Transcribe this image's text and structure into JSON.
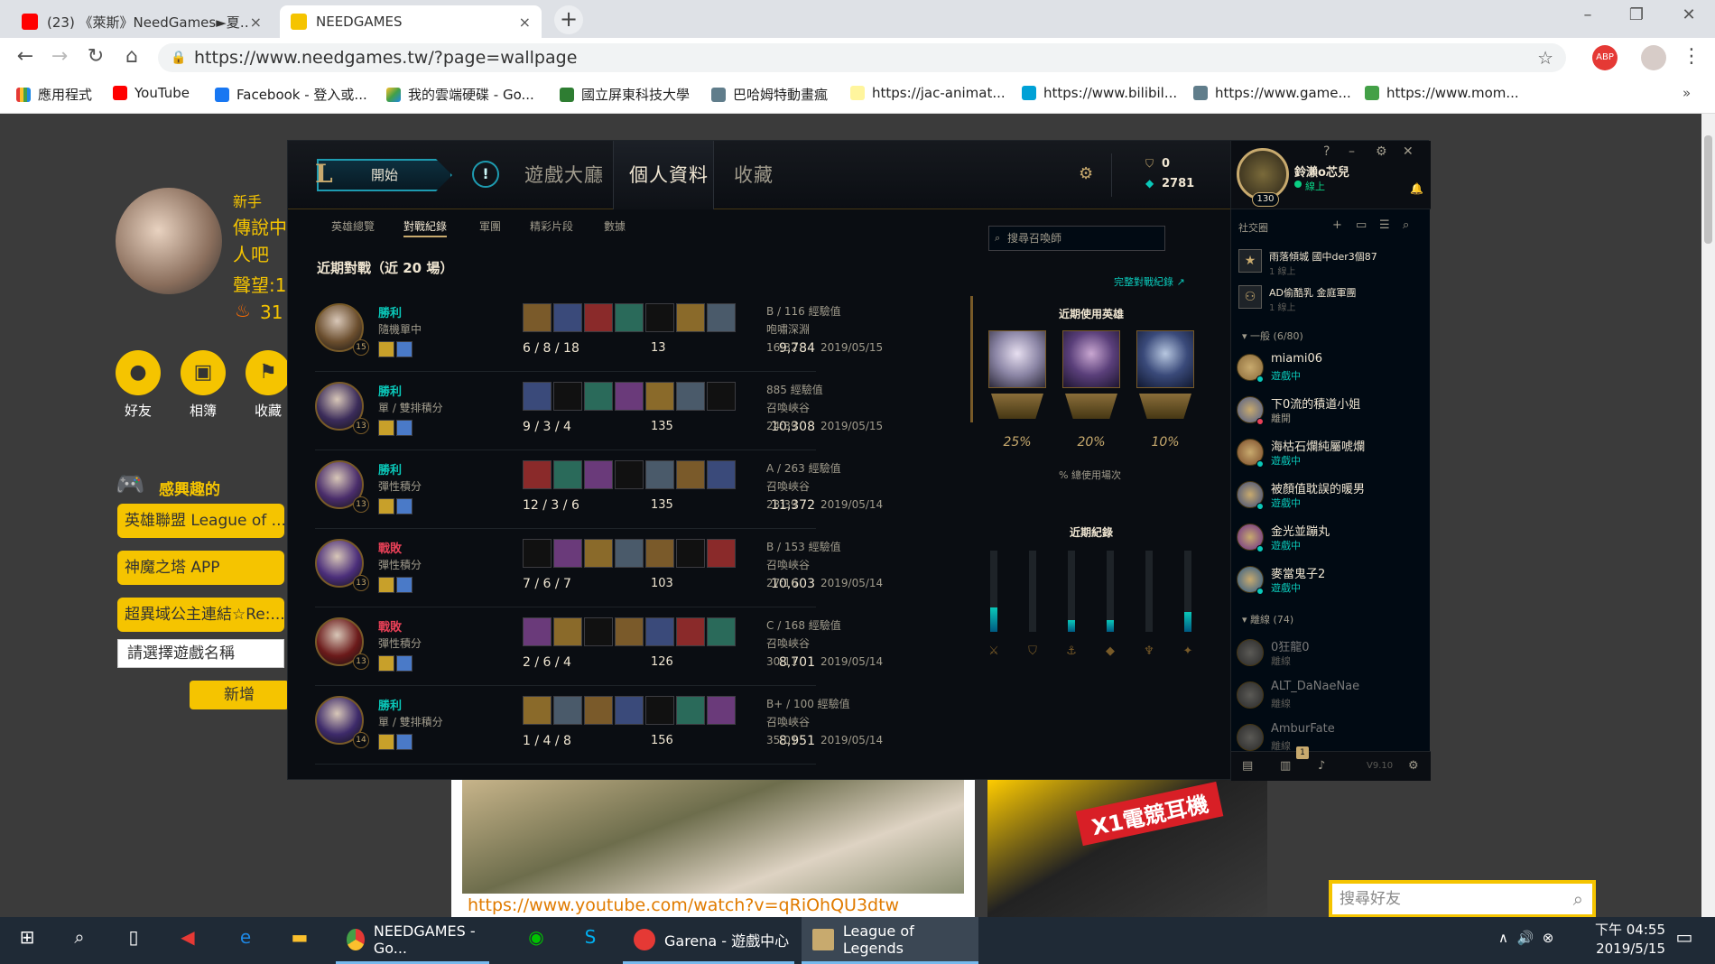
{
  "browser": {
    "tabs": [
      {
        "title": "(23) 《萊斯》NeedGames►夏…",
        "close": "×"
      },
      {
        "title": "NEEDGAMES",
        "close": "×"
      }
    ],
    "new_tab": "+",
    "url": "https://www.needgames.tw/?page=wallpage",
    "bookmarks": [
      "應用程式",
      "YouTube",
      "Facebook - 登入或...",
      "我的雲端硬碟 - Go...",
      "國立屏東科技大學",
      "巴哈姆特動畫瘋",
      "https://jac-animat...",
      "https://www.bilibil...",
      "https://www.game...",
      "https://www.mom..."
    ],
    "more": "»"
  },
  "page": {
    "profile": {
      "rank": "新手",
      "title_lines": [
        "傳說中",
        "人吧"
      ],
      "reputation": "聲望:1",
      "fire_count": "31"
    },
    "actions": [
      {
        "label": "好友",
        "icon": "person-icon"
      },
      {
        "label": "相簿",
        "icon": "camera-icon"
      },
      {
        "label": "收藏",
        "icon": "bookmark-icon"
      }
    ],
    "interest_title": "感興趣的",
    "interests": [
      "英雄聯盟 League of ...",
      "神魔之塔 APP",
      "超異域公主連結☆Re:..."
    ],
    "select_placeholder": "請選擇遊戲名稱",
    "add_button": "新增",
    "post_url": "https://www.youtube.com/watch?v=qRiOhQU3dtw",
    "ad_text": "X1電競耳機",
    "friend_search_placeholder": "搜尋好友"
  },
  "lol": {
    "play": "開始",
    "nav": [
      "遊戲大廳",
      "個人資料",
      "收藏"
    ],
    "currency": {
      "rp": "0",
      "be": "2781"
    },
    "subnav": [
      "英雄總覽",
      "對戰紀錄",
      "軍團",
      "精彩片段",
      "數據"
    ],
    "recent_title": "近期對戰（近 20 場）",
    "search_placeholder": "搜尋召喚師",
    "full_history": "完整對戰紀錄 ↗",
    "matches": [
      {
        "result": "勝利",
        "win": true,
        "mode": "隨機單中",
        "level": "15",
        "kda": "6 / 8 / 18",
        "cs": "13",
        "gold": "9,784",
        "grade": "B / 116 經驗值",
        "map": "咆嘯深淵",
        "duration": "16:32",
        "date": "2019/05/15"
      },
      {
        "result": "勝利",
        "win": true,
        "mode": "單 / 雙排積分",
        "level": "13",
        "kda": "9 / 3 / 4",
        "cs": "135",
        "gold": "10,308",
        "grade": "885 經驗值",
        "map": "召喚峽谷",
        "duration": "24:39",
        "date": "2019/05/15"
      },
      {
        "result": "勝利",
        "win": true,
        "mode": "彈性積分",
        "level": "13",
        "kda": "12 / 3 / 6",
        "cs": "135",
        "gold": "11,372",
        "grade": "A / 263 經驗值",
        "map": "召喚峽谷",
        "duration": "23:39",
        "date": "2019/05/14"
      },
      {
        "result": "戰敗",
        "win": false,
        "mode": "彈性積分",
        "level": "13",
        "kda": "7 / 6 / 7",
        "cs": "103",
        "gold": "10,603",
        "grade": "B / 153 經驗值",
        "map": "召喚峽谷",
        "duration": "27:16",
        "date": "2019/05/14"
      },
      {
        "result": "戰敗",
        "win": false,
        "mode": "彈性積分",
        "level": "13",
        "kda": "2 / 6 / 4",
        "cs": "126",
        "gold": "8,701",
        "grade": "C / 168 經驗值",
        "map": "召喚峽谷",
        "duration": "30:11",
        "date": "2019/05/14"
      },
      {
        "result": "勝利",
        "win": true,
        "mode": "單 / 雙排積分",
        "level": "14",
        "kda": "1 / 4 / 8",
        "cs": "156",
        "gold": "8,951",
        "grade": "B+ / 100 經驗值",
        "map": "召喚峽谷",
        "duration": "35:01",
        "date": "2019/05/14"
      }
    ],
    "top_champs_title": "近期使用英雄",
    "top_champs_pct": [
      "25%",
      "20%",
      "10%"
    ],
    "pct_note": "% 總使用場次",
    "recent_record_title": "近期紀錄",
    "role_levels": [
      0.3,
      0,
      0.15,
      0.15,
      0,
      0.25
    ],
    "summoner": {
      "name": "鈴瀨o芯兒",
      "status": "線上",
      "level": "130"
    },
    "social": {
      "header": "社交圈",
      "clubs": [
        {
          "name": "雨落傾城 國中der3個87",
          "sub": "1 線上"
        },
        {
          "name": "AD偷酷乳 金庭軍團",
          "sub": "1 線上"
        }
      ],
      "group_general": "一般 (6/80)",
      "group_offline": "離線 (74)",
      "friends": [
        {
          "name": "miami06",
          "status": "遊戲中",
          "type": "ingame"
        },
        {
          "name": "下0流的積道小姐",
          "status": "離開",
          "type": "away"
        },
        {
          "name": "海枯石爛純屬唬爛",
          "status": "遊戲中",
          "type": "ingame"
        },
        {
          "name": "被顏值耽誤的暖男",
          "status": "遊戲中",
          "type": "ingame"
        },
        {
          "name": "金光並蹦丸",
          "status": "遊戲中",
          "type": "ingame"
        },
        {
          "name": "麥當鬼子2",
          "status": "遊戲中",
          "type": "ingame"
        }
      ],
      "offline_friends": [
        {
          "name": "0狂龍0",
          "status": "離線"
        },
        {
          "name": "ALT_DaNaeNae",
          "status": "離線"
        },
        {
          "name": "AmburFate",
          "status": "離線"
        }
      ],
      "version": "V9.10",
      "notif": "1"
    }
  },
  "taskbar": {
    "apps": [
      "NEEDGAMES - Go...",
      "Garena - 遊戲中心",
      "League of Legends"
    ],
    "time": "下午 04:55",
    "date": "2019/5/15"
  }
}
